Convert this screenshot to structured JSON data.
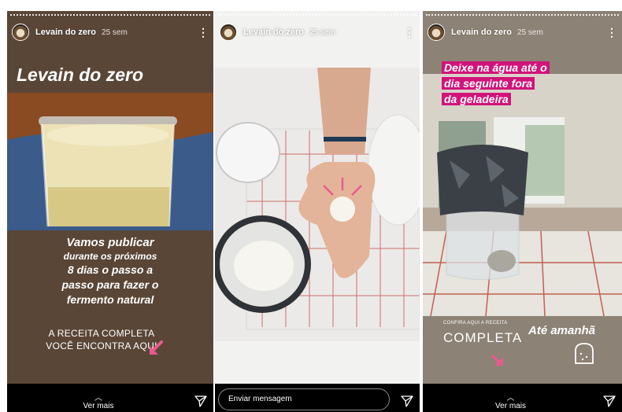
{
  "stories": [
    {
      "username": "Levain do zero",
      "time": "25 sem",
      "title": "Levain do zero",
      "body_line1": "Vamos publicar",
      "body_line2": "durante os próximos",
      "body_line3": "8 dias o passo a",
      "body_line4": "passo para fazer o",
      "body_line5": "fermento natural",
      "cta_line1": "A RECEITA COMPLETA",
      "cta_line2": "VOCÊ ENCONTRA AQUI",
      "footer": "Ver mais"
    },
    {
      "username": "Levain do zero",
      "time": "25 sem",
      "message_placeholder": "Enviar mensagem"
    },
    {
      "username": "Levain do zero",
      "time": "25 sem",
      "caption_line1": "Deixe na água até o",
      "caption_line2": "dia seguinte fora",
      "caption_line3": "da geladeira",
      "small_text": "CONFIRA AQUI A RECEITA",
      "completa": "COMPLETA",
      "ate_amanha": "Até amanhã",
      "footer": "Ver mais"
    }
  ],
  "icons": {
    "more": "more-vertical-icon",
    "send": "paper-plane-icon",
    "arrow": "pointing-arrow-icon",
    "bread": "bread-icon"
  },
  "colors": {
    "accent_pink": "#d1147a",
    "arrow_pink": "#e85a8f"
  }
}
